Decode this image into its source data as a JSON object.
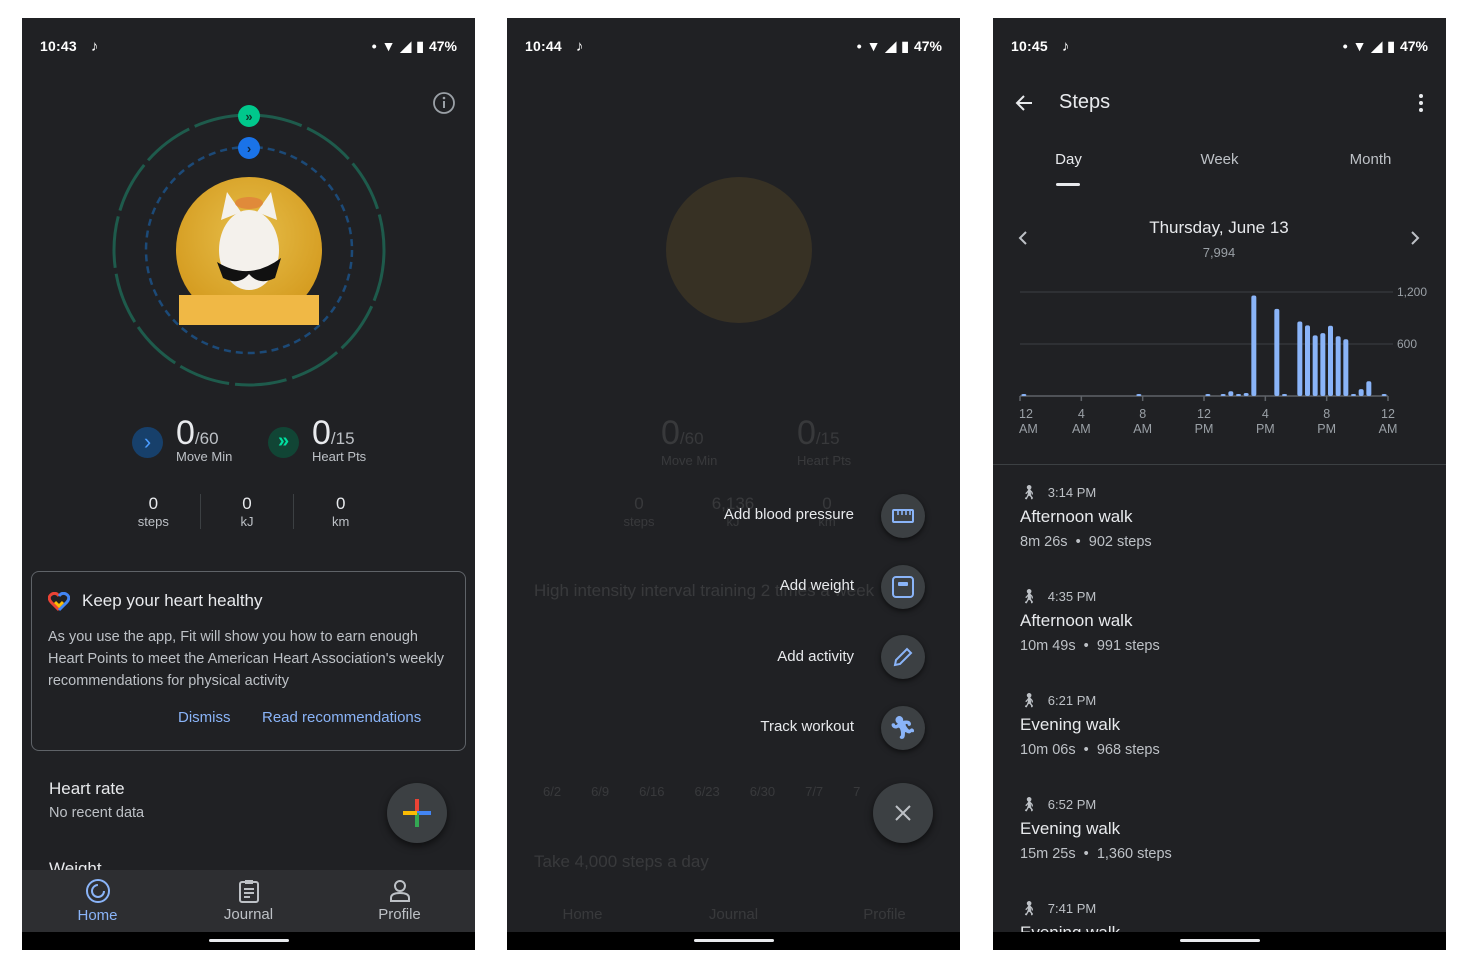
{
  "colors": {
    "background": "#202124",
    "accent_blue": "#8ab4f8",
    "move_blue": "#1a73e8",
    "heart_green": "#00c88c",
    "bar": "#8ab4f8"
  },
  "screens": [
    {
      "status": {
        "time": "10:43",
        "battery": "47%"
      },
      "goals": {
        "move_value": "0",
        "move_goal": "/60",
        "move_label": "Move Min",
        "heart_value": "0",
        "heart_goal": "/15",
        "heart_label": "Heart Pts"
      },
      "stats": [
        {
          "value": "0",
          "label": "steps"
        },
        {
          "value": "0",
          "label": "kJ"
        },
        {
          "value": "0",
          "label": "km"
        }
      ],
      "card": {
        "title": "Keep your heart healthy",
        "body": "As you use the app, Fit will show you how to earn enough Heart Points to meet the American Heart Association's weekly recommendations for physical activity",
        "dismiss": "Dismiss",
        "read": "Read recommendations"
      },
      "heart_rate": {
        "title": "Heart rate",
        "subtitle": "No recent data"
      },
      "weight": {
        "title": "Weight"
      },
      "nav": [
        {
          "label": "Home",
          "icon": "home-ring-icon",
          "active": true
        },
        {
          "label": "Journal",
          "icon": "clipboard-icon"
        },
        {
          "label": "Profile",
          "icon": "person-icon"
        }
      ]
    },
    {
      "status": {
        "time": "10:44",
        "battery": "47%"
      },
      "background": {
        "move_value": "0",
        "move_goal": "/60",
        "move_label": "Move Min",
        "heart_value": "0",
        "heart_goal": "/15",
        "heart_label": "Heart Pts",
        "steps": "0",
        "steps_label": "steps",
        "kj": "6,136",
        "kj_label": "kJ",
        "km": "0",
        "km_label": "km",
        "goal1": "High intensity interval training 2 times a week",
        "ticks": [
          "6/2",
          "6/9",
          "6/16",
          "6/23",
          "6/30",
          "7/7",
          "7"
        ],
        "goal2": "Take 4,000 steps a day",
        "nav": [
          "Home",
          "Journal",
          "Profile"
        ]
      },
      "menu": [
        {
          "label": "Add blood pressure",
          "icon": "blood-pressure-icon"
        },
        {
          "label": "Add weight",
          "icon": "scale-icon"
        },
        {
          "label": "Add activity",
          "icon": "pencil-icon"
        },
        {
          "label": "Track workout",
          "icon": "running-icon"
        }
      ]
    },
    {
      "status": {
        "time": "10:45",
        "battery": "47%"
      },
      "header": {
        "title": "Steps"
      },
      "tabs": [
        {
          "label": "Day",
          "active": true
        },
        {
          "label": "Week"
        },
        {
          "label": "Month"
        }
      ],
      "date": {
        "label": "Thursday, June 13",
        "total": "7,994"
      },
      "activities": [
        {
          "time": "3:14 PM",
          "title": "Afternoon walk",
          "duration": "8m 26s",
          "steps": "902 steps"
        },
        {
          "time": "4:35 PM",
          "title": "Afternoon walk",
          "duration": "10m 49s",
          "steps": "991 steps"
        },
        {
          "time": "6:21 PM",
          "title": "Evening walk",
          "duration": "10m 06s",
          "steps": "968 steps"
        },
        {
          "time": "6:52 PM",
          "title": "Evening walk",
          "duration": "15m 25s",
          "steps": "1,360 steps"
        },
        {
          "time": "7:41 PM",
          "title": "Evening walk"
        }
      ]
    }
  ],
  "chart_data": {
    "type": "bar",
    "xlim": [
      0,
      24
    ],
    "ylim": [
      0,
      1200
    ],
    "yticks": [
      {
        "value": 1200,
        "label": "1,200"
      },
      {
        "value": 600,
        "label": "600"
      }
    ],
    "xticks": [
      {
        "value": 0,
        "label": [
          "12",
          "AM"
        ]
      },
      {
        "value": 4,
        "label": [
          "4",
          "AM"
        ]
      },
      {
        "value": 8,
        "label": [
          "8",
          "AM"
        ]
      },
      {
        "value": 12,
        "label": [
          "12",
          "PM"
        ]
      },
      {
        "value": 16,
        "label": [
          "4",
          "PM"
        ]
      },
      {
        "value": 20,
        "label": [
          "8",
          "PM"
        ]
      },
      {
        "value": 24,
        "label": [
          "12",
          "AM"
        ]
      }
    ],
    "grid": true,
    "x": [
      0.25,
      7.75,
      12.25,
      13.25,
      13.75,
      14.25,
      14.75,
      15.25,
      16.75,
      17.25,
      18.25,
      18.75,
      19.25,
      19.75,
      20.25,
      20.75,
      21.25,
      21.75,
      22.25,
      22.75,
      23.75
    ],
    "values": [
      5,
      10,
      10,
      5,
      55,
      15,
      35,
      1160,
      1005,
      15,
      860,
      815,
      700,
      725,
      810,
      690,
      655,
      10,
      80,
      170,
      10
    ]
  }
}
